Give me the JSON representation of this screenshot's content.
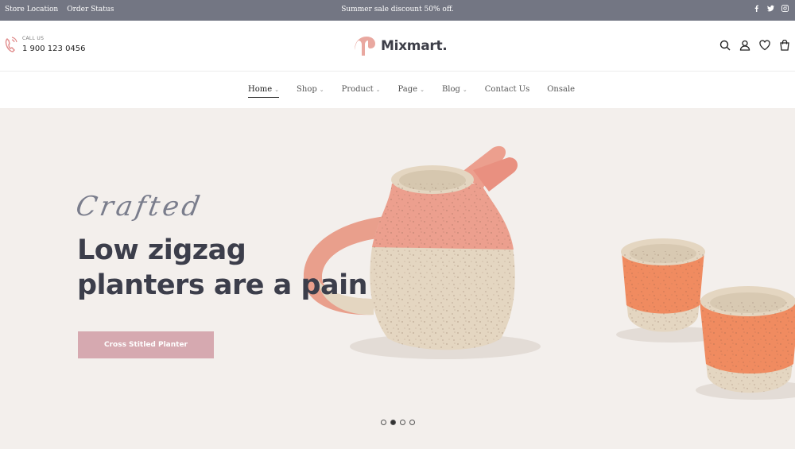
{
  "topbar": {
    "links": [
      "Store Location",
      "Order Status"
    ],
    "promo": "Summer sale discount 50% off.",
    "social_icons": [
      "facebook-icon",
      "twitter-icon",
      "instagram-icon"
    ]
  },
  "header": {
    "call_label": "CALL US",
    "phone": "1 900 123 0456",
    "brand": "Mixmart.",
    "icons": [
      "search-icon",
      "user-icon",
      "heart-icon",
      "cart-icon"
    ]
  },
  "nav": {
    "items": [
      {
        "label": "Home",
        "dropdown": true,
        "active": true
      },
      {
        "label": "Shop",
        "dropdown": true
      },
      {
        "label": "Product",
        "dropdown": true
      },
      {
        "label": "Page",
        "dropdown": true
      },
      {
        "label": "Blog",
        "dropdown": true
      },
      {
        "label": "Contact Us",
        "dropdown": false
      },
      {
        "label": "Onsale",
        "dropdown": false
      }
    ]
  },
  "hero": {
    "script_text": "Crafted",
    "headline": [
      "Low zigzag",
      "planters are a pain"
    ],
    "cta": "Cross Stitled Planter",
    "slides": 4,
    "active_slide": 2
  },
  "colors": {
    "topbar": "#737683",
    "accent": "#d6a9b0",
    "hero_bg": "#f3efec",
    "heading": "#3c3e4b"
  }
}
